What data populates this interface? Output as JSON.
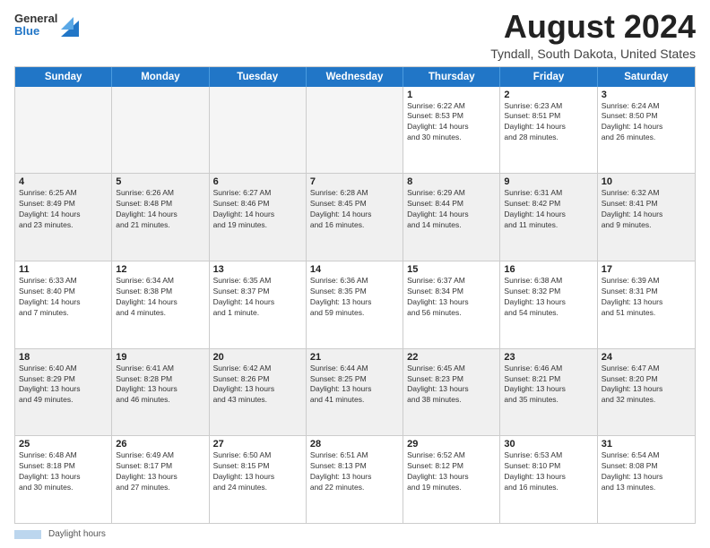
{
  "logo": {
    "general": "General",
    "blue": "Blue"
  },
  "title": "August 2024",
  "subtitle": "Tyndall, South Dakota, United States",
  "days_of_week": [
    "Sunday",
    "Monday",
    "Tuesday",
    "Wednesday",
    "Thursday",
    "Friday",
    "Saturday"
  ],
  "footer": {
    "daylight_label": "Daylight hours"
  },
  "weeks": [
    [
      {
        "day": "",
        "info": "",
        "empty": true
      },
      {
        "day": "",
        "info": "",
        "empty": true
      },
      {
        "day": "",
        "info": "",
        "empty": true
      },
      {
        "day": "",
        "info": "",
        "empty": true
      },
      {
        "day": "1",
        "info": "Sunrise: 6:22 AM\nSunset: 8:53 PM\nDaylight: 14 hours\nand 30 minutes."
      },
      {
        "day": "2",
        "info": "Sunrise: 6:23 AM\nSunset: 8:51 PM\nDaylight: 14 hours\nand 28 minutes."
      },
      {
        "day": "3",
        "info": "Sunrise: 6:24 AM\nSunset: 8:50 PM\nDaylight: 14 hours\nand 26 minutes."
      }
    ],
    [
      {
        "day": "4",
        "info": "Sunrise: 6:25 AM\nSunset: 8:49 PM\nDaylight: 14 hours\nand 23 minutes."
      },
      {
        "day": "5",
        "info": "Sunrise: 6:26 AM\nSunset: 8:48 PM\nDaylight: 14 hours\nand 21 minutes."
      },
      {
        "day": "6",
        "info": "Sunrise: 6:27 AM\nSunset: 8:46 PM\nDaylight: 14 hours\nand 19 minutes."
      },
      {
        "day": "7",
        "info": "Sunrise: 6:28 AM\nSunset: 8:45 PM\nDaylight: 14 hours\nand 16 minutes."
      },
      {
        "day": "8",
        "info": "Sunrise: 6:29 AM\nSunset: 8:44 PM\nDaylight: 14 hours\nand 14 minutes."
      },
      {
        "day": "9",
        "info": "Sunrise: 6:31 AM\nSunset: 8:42 PM\nDaylight: 14 hours\nand 11 minutes."
      },
      {
        "day": "10",
        "info": "Sunrise: 6:32 AM\nSunset: 8:41 PM\nDaylight: 14 hours\nand 9 minutes."
      }
    ],
    [
      {
        "day": "11",
        "info": "Sunrise: 6:33 AM\nSunset: 8:40 PM\nDaylight: 14 hours\nand 7 minutes."
      },
      {
        "day": "12",
        "info": "Sunrise: 6:34 AM\nSunset: 8:38 PM\nDaylight: 14 hours\nand 4 minutes."
      },
      {
        "day": "13",
        "info": "Sunrise: 6:35 AM\nSunset: 8:37 PM\nDaylight: 14 hours\nand 1 minute."
      },
      {
        "day": "14",
        "info": "Sunrise: 6:36 AM\nSunset: 8:35 PM\nDaylight: 13 hours\nand 59 minutes."
      },
      {
        "day": "15",
        "info": "Sunrise: 6:37 AM\nSunset: 8:34 PM\nDaylight: 13 hours\nand 56 minutes."
      },
      {
        "day": "16",
        "info": "Sunrise: 6:38 AM\nSunset: 8:32 PM\nDaylight: 13 hours\nand 54 minutes."
      },
      {
        "day": "17",
        "info": "Sunrise: 6:39 AM\nSunset: 8:31 PM\nDaylight: 13 hours\nand 51 minutes."
      }
    ],
    [
      {
        "day": "18",
        "info": "Sunrise: 6:40 AM\nSunset: 8:29 PM\nDaylight: 13 hours\nand 49 minutes."
      },
      {
        "day": "19",
        "info": "Sunrise: 6:41 AM\nSunset: 8:28 PM\nDaylight: 13 hours\nand 46 minutes."
      },
      {
        "day": "20",
        "info": "Sunrise: 6:42 AM\nSunset: 8:26 PM\nDaylight: 13 hours\nand 43 minutes."
      },
      {
        "day": "21",
        "info": "Sunrise: 6:44 AM\nSunset: 8:25 PM\nDaylight: 13 hours\nand 41 minutes."
      },
      {
        "day": "22",
        "info": "Sunrise: 6:45 AM\nSunset: 8:23 PM\nDaylight: 13 hours\nand 38 minutes."
      },
      {
        "day": "23",
        "info": "Sunrise: 6:46 AM\nSunset: 8:21 PM\nDaylight: 13 hours\nand 35 minutes."
      },
      {
        "day": "24",
        "info": "Sunrise: 6:47 AM\nSunset: 8:20 PM\nDaylight: 13 hours\nand 32 minutes."
      }
    ],
    [
      {
        "day": "25",
        "info": "Sunrise: 6:48 AM\nSunset: 8:18 PM\nDaylight: 13 hours\nand 30 minutes."
      },
      {
        "day": "26",
        "info": "Sunrise: 6:49 AM\nSunset: 8:17 PM\nDaylight: 13 hours\nand 27 minutes."
      },
      {
        "day": "27",
        "info": "Sunrise: 6:50 AM\nSunset: 8:15 PM\nDaylight: 13 hours\nand 24 minutes."
      },
      {
        "day": "28",
        "info": "Sunrise: 6:51 AM\nSunset: 8:13 PM\nDaylight: 13 hours\nand 22 minutes."
      },
      {
        "day": "29",
        "info": "Sunrise: 6:52 AM\nSunset: 8:12 PM\nDaylight: 13 hours\nand 19 minutes."
      },
      {
        "day": "30",
        "info": "Sunrise: 6:53 AM\nSunset: 8:10 PM\nDaylight: 13 hours\nand 16 minutes."
      },
      {
        "day": "31",
        "info": "Sunrise: 6:54 AM\nSunset: 8:08 PM\nDaylight: 13 hours\nand 13 minutes."
      }
    ]
  ]
}
